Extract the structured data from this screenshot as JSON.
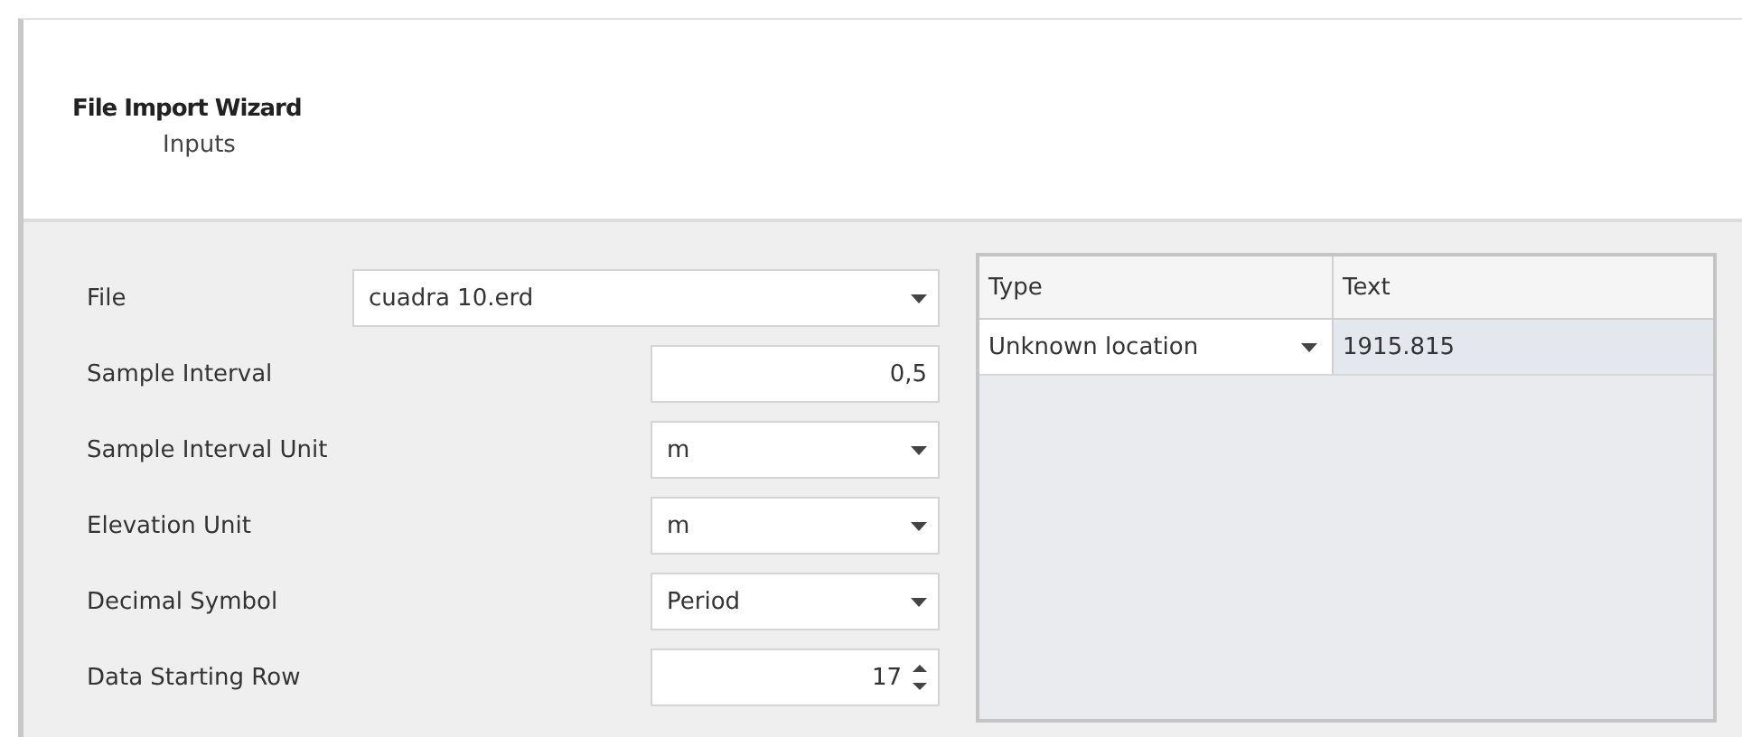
{
  "wizard": {
    "title": "File Import Wizard",
    "subtitle": "Inputs"
  },
  "fields": [
    {
      "label": "File",
      "kind": "path",
      "value": "cuadra 10.erd"
    },
    {
      "label": "Sample Interval",
      "kind": "number",
      "value": "0,5"
    },
    {
      "label": "Sample Interval Unit",
      "kind": "combo",
      "value": "m"
    },
    {
      "label": "Elevation Unit",
      "kind": "combo",
      "value": "m"
    },
    {
      "label": "Decimal Symbol",
      "kind": "combo",
      "value": "Period"
    },
    {
      "label": "Data Starting Row",
      "kind": "spinner",
      "value": "17"
    }
  ],
  "grid": {
    "columns": [
      "Type",
      "Text"
    ],
    "rows": [
      {
        "type": "Unknown location",
        "text": "1915.815"
      }
    ]
  }
}
